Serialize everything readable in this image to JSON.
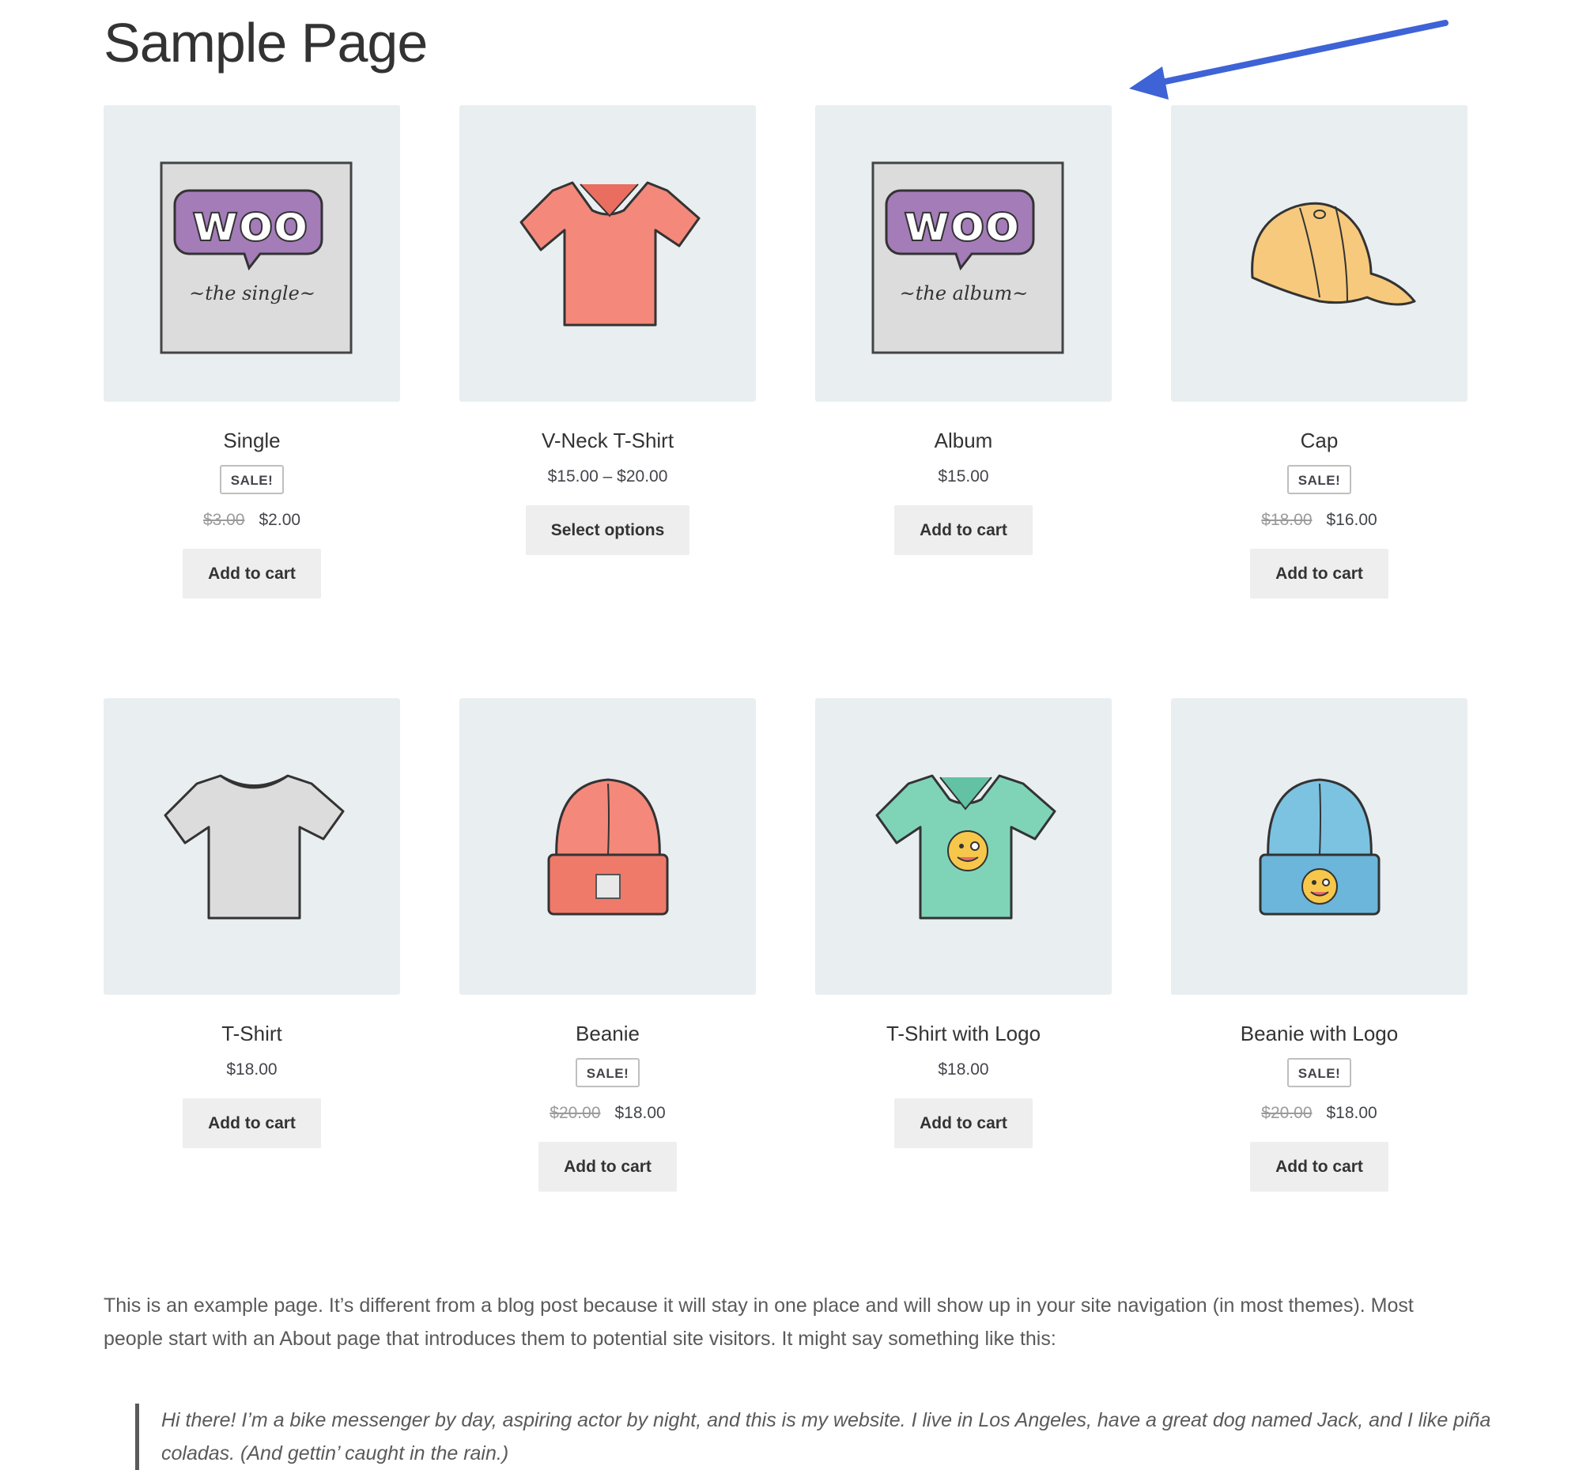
{
  "page": {
    "title": "Sample Page"
  },
  "colors": {
    "annotation_arrow": "#3e63d6",
    "thumb_bg": "#e9eef1",
    "button_bg": "#eeeeee"
  },
  "products": [
    {
      "name": "Single",
      "sale_badge": "SALE!",
      "old_price": "$3.00",
      "price": "$2.00",
      "button": "Add to cart",
      "image": "woo-single-icon"
    },
    {
      "name": "V-Neck T-Shirt",
      "sale_badge": "",
      "old_price": "",
      "price": "$15.00 – $20.00",
      "button": "Select options",
      "image": "vneck-tshirt-icon"
    },
    {
      "name": "Album",
      "sale_badge": "",
      "old_price": "",
      "price": "$15.00",
      "button": "Add to cart",
      "image": "woo-album-icon"
    },
    {
      "name": "Cap",
      "sale_badge": "SALE!",
      "old_price": "$18.00",
      "price": "$16.00",
      "button": "Add to cart",
      "image": "cap-icon"
    },
    {
      "name": "T-Shirt",
      "sale_badge": "",
      "old_price": "",
      "price": "$18.00",
      "button": "Add to cart",
      "image": "tshirt-icon"
    },
    {
      "name": "Beanie",
      "sale_badge": "SALE!",
      "old_price": "$20.00",
      "price": "$18.00",
      "button": "Add to cart",
      "image": "beanie-icon"
    },
    {
      "name": "T-Shirt with Logo",
      "sale_badge": "",
      "old_price": "",
      "price": "$18.00",
      "button": "Add to cart",
      "image": "tshirt-logo-icon"
    },
    {
      "name": "Beanie with Logo",
      "sale_badge": "SALE!",
      "old_price": "$20.00",
      "price": "$18.00",
      "button": "Add to cart",
      "image": "beanie-logo-icon"
    }
  ],
  "content": {
    "paragraph": "This is an example page. It’s different from a blog post because it will stay in one place and will show up in your site navigation (in most themes). Most people start with an About page that introduces them to potential site visitors. It might say something like this:",
    "quote": "Hi there! I’m a bike messenger by day, aspiring actor by night, and this is my website. I live in Los Angeles, have a great dog named Jack, and I like piña coladas. (And gettin’ caught in the rain.)"
  }
}
